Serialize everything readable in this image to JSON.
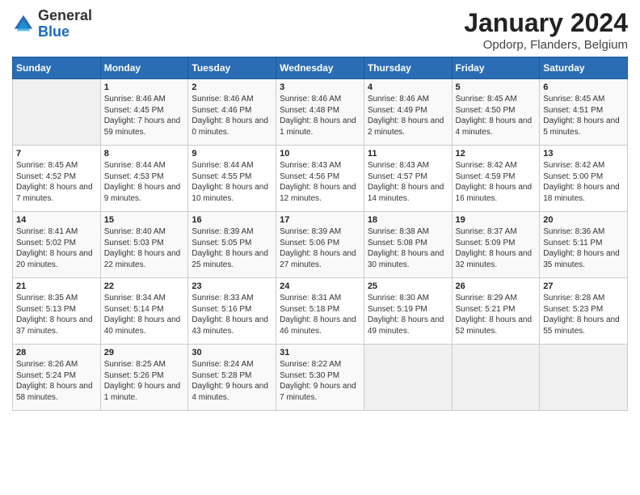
{
  "logo": {
    "general": "General",
    "blue": "Blue"
  },
  "title": "January 2024",
  "subtitle": "Opdorp, Flanders, Belgium",
  "days_of_week": [
    "Sunday",
    "Monday",
    "Tuesday",
    "Wednesday",
    "Thursday",
    "Friday",
    "Saturday"
  ],
  "weeks": [
    [
      {
        "num": "",
        "info": ""
      },
      {
        "num": "1",
        "info": "Sunrise: 8:46 AM\nSunset: 4:45 PM\nDaylight: 7 hours\nand 59 minutes."
      },
      {
        "num": "2",
        "info": "Sunrise: 8:46 AM\nSunset: 4:46 PM\nDaylight: 8 hours\nand 0 minutes."
      },
      {
        "num": "3",
        "info": "Sunrise: 8:46 AM\nSunset: 4:48 PM\nDaylight: 8 hours\nand 1 minute."
      },
      {
        "num": "4",
        "info": "Sunrise: 8:46 AM\nSunset: 4:49 PM\nDaylight: 8 hours\nand 2 minutes."
      },
      {
        "num": "5",
        "info": "Sunrise: 8:45 AM\nSunset: 4:50 PM\nDaylight: 8 hours\nand 4 minutes."
      },
      {
        "num": "6",
        "info": "Sunrise: 8:45 AM\nSunset: 4:51 PM\nDaylight: 8 hours\nand 5 minutes."
      }
    ],
    [
      {
        "num": "7",
        "info": "Sunrise: 8:45 AM\nSunset: 4:52 PM\nDaylight: 8 hours\nand 7 minutes."
      },
      {
        "num": "8",
        "info": "Sunrise: 8:44 AM\nSunset: 4:53 PM\nDaylight: 8 hours\nand 9 minutes."
      },
      {
        "num": "9",
        "info": "Sunrise: 8:44 AM\nSunset: 4:55 PM\nDaylight: 8 hours\nand 10 minutes."
      },
      {
        "num": "10",
        "info": "Sunrise: 8:43 AM\nSunset: 4:56 PM\nDaylight: 8 hours\nand 12 minutes."
      },
      {
        "num": "11",
        "info": "Sunrise: 8:43 AM\nSunset: 4:57 PM\nDaylight: 8 hours\nand 14 minutes."
      },
      {
        "num": "12",
        "info": "Sunrise: 8:42 AM\nSunset: 4:59 PM\nDaylight: 8 hours\nand 16 minutes."
      },
      {
        "num": "13",
        "info": "Sunrise: 8:42 AM\nSunset: 5:00 PM\nDaylight: 8 hours\nand 18 minutes."
      }
    ],
    [
      {
        "num": "14",
        "info": "Sunrise: 8:41 AM\nSunset: 5:02 PM\nDaylight: 8 hours\nand 20 minutes."
      },
      {
        "num": "15",
        "info": "Sunrise: 8:40 AM\nSunset: 5:03 PM\nDaylight: 8 hours\nand 22 minutes."
      },
      {
        "num": "16",
        "info": "Sunrise: 8:39 AM\nSunset: 5:05 PM\nDaylight: 8 hours\nand 25 minutes."
      },
      {
        "num": "17",
        "info": "Sunrise: 8:39 AM\nSunset: 5:06 PM\nDaylight: 8 hours\nand 27 minutes."
      },
      {
        "num": "18",
        "info": "Sunrise: 8:38 AM\nSunset: 5:08 PM\nDaylight: 8 hours\nand 30 minutes."
      },
      {
        "num": "19",
        "info": "Sunrise: 8:37 AM\nSunset: 5:09 PM\nDaylight: 8 hours\nand 32 minutes."
      },
      {
        "num": "20",
        "info": "Sunrise: 8:36 AM\nSunset: 5:11 PM\nDaylight: 8 hours\nand 35 minutes."
      }
    ],
    [
      {
        "num": "21",
        "info": "Sunrise: 8:35 AM\nSunset: 5:13 PM\nDaylight: 8 hours\nand 37 minutes."
      },
      {
        "num": "22",
        "info": "Sunrise: 8:34 AM\nSunset: 5:14 PM\nDaylight: 8 hours\nand 40 minutes."
      },
      {
        "num": "23",
        "info": "Sunrise: 8:33 AM\nSunset: 5:16 PM\nDaylight: 8 hours\nand 43 minutes."
      },
      {
        "num": "24",
        "info": "Sunrise: 8:31 AM\nSunset: 5:18 PM\nDaylight: 8 hours\nand 46 minutes."
      },
      {
        "num": "25",
        "info": "Sunrise: 8:30 AM\nSunset: 5:19 PM\nDaylight: 8 hours\nand 49 minutes."
      },
      {
        "num": "26",
        "info": "Sunrise: 8:29 AM\nSunset: 5:21 PM\nDaylight: 8 hours\nand 52 minutes."
      },
      {
        "num": "27",
        "info": "Sunrise: 8:28 AM\nSunset: 5:23 PM\nDaylight: 8 hours\nand 55 minutes."
      }
    ],
    [
      {
        "num": "28",
        "info": "Sunrise: 8:26 AM\nSunset: 5:24 PM\nDaylight: 8 hours\nand 58 minutes."
      },
      {
        "num": "29",
        "info": "Sunrise: 8:25 AM\nSunset: 5:26 PM\nDaylight: 9 hours\nand 1 minute."
      },
      {
        "num": "30",
        "info": "Sunrise: 8:24 AM\nSunset: 5:28 PM\nDaylight: 9 hours\nand 4 minutes."
      },
      {
        "num": "31",
        "info": "Sunrise: 8:22 AM\nSunset: 5:30 PM\nDaylight: 9 hours\nand 7 minutes."
      },
      {
        "num": "",
        "info": ""
      },
      {
        "num": "",
        "info": ""
      },
      {
        "num": "",
        "info": ""
      }
    ]
  ]
}
